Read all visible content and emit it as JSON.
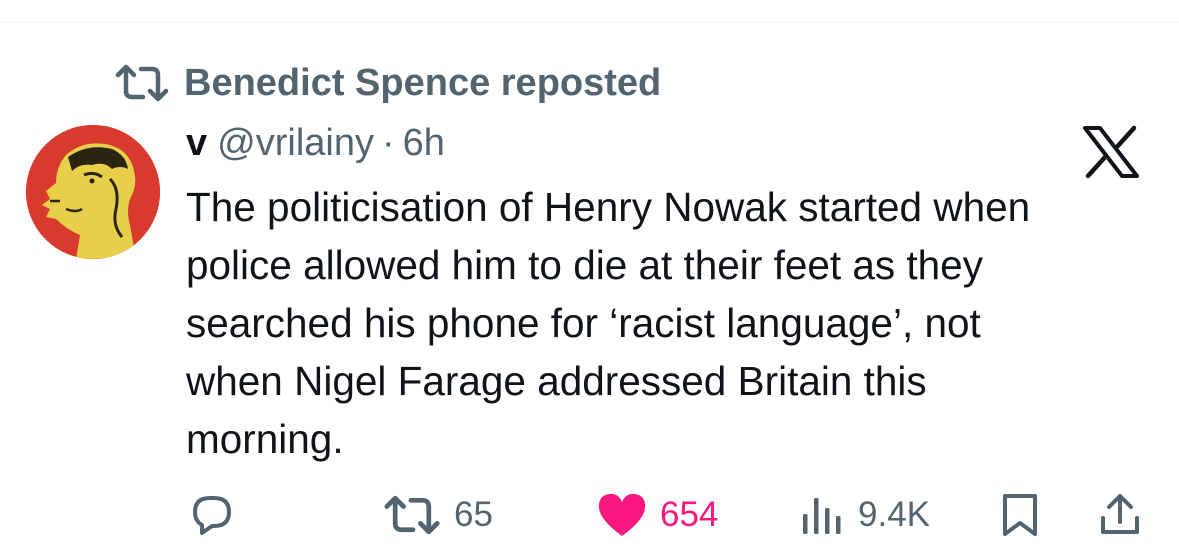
{
  "repost_banner": {
    "label": "Benedict Spence reposted",
    "icon": "repost-icon"
  },
  "post": {
    "author_name": "v",
    "author_handle": "@vrilainy",
    "separator": "·",
    "time": "6h",
    "text": "The politicisation of Henry Nowak started when\npolice allowed him to die at their feet as they\nsearched his phone for ‘racist language’, not\nwhen Nigel Farage addressed Britain this\nmorning.",
    "platform_icon": "x-logo-icon",
    "avatar_icon": "napoleon-profile-avatar"
  },
  "actions": {
    "reply": {
      "icon": "reply-icon"
    },
    "repost": {
      "icon": "repost-icon",
      "count": "65"
    },
    "like": {
      "icon": "heart-icon",
      "count": "654",
      "active": true
    },
    "views": {
      "icon": "views-chart-icon",
      "count": "9.4K"
    },
    "bookmark": {
      "icon": "bookmark-icon"
    },
    "share": {
      "icon": "share-icon"
    }
  },
  "colors": {
    "text_primary": "#0f1419",
    "text_secondary": "#536471",
    "like_active": "#f91880",
    "avatar_background": "#d83a2d"
  }
}
